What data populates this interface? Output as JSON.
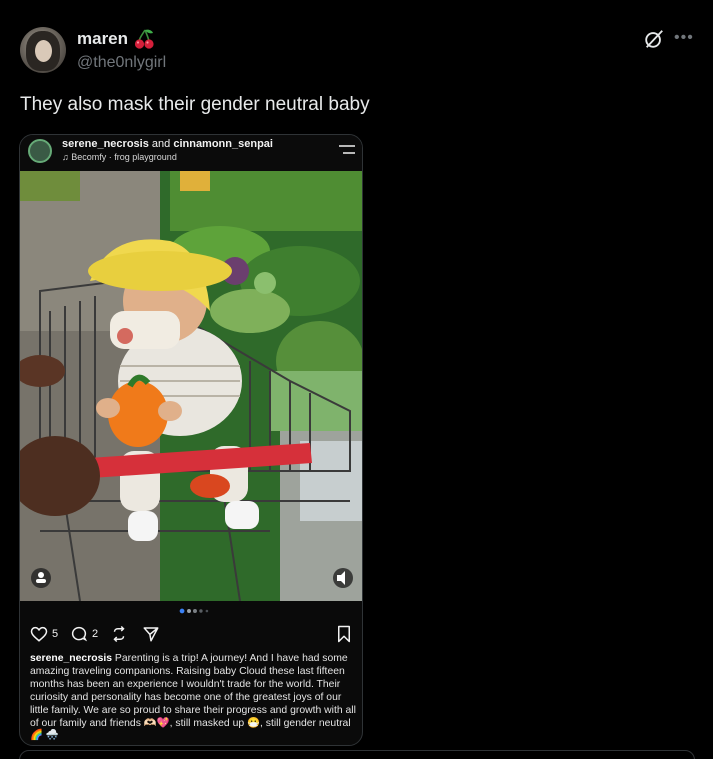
{
  "author": {
    "display_name": "maren",
    "handle": "@the0nlygirl",
    "badge_icon": "cherry-icon"
  },
  "header_icons": [
    "grok-icon",
    "more-icon"
  ],
  "more_glyph": "•••",
  "tweet": {
    "text": "They also mask their gender neutral baby"
  },
  "embedded_post": {
    "user1": "serene_necrosis",
    "and_text": "and",
    "user2": "cinnamonn_senpai",
    "music": "Becomfy · frog playground",
    "likes": "5",
    "comments": "2",
    "caption_user": "serene_necrosis",
    "caption_text": "Parenting is a trip! A journey! And I have had some amazing traveling companions. Raising baby Cloud these last fifteen months has been an experience I wouldn't trade for the world. Their curiosity and personality has become one of the greatest joys of our little family. We are so proud to share their progress and growth with all of our family and friends 🫶🏻💖, still masked up 😷, still gender neutral 🌈 🌨️"
  },
  "colors": {
    "background": "#000000",
    "text_primary": "#e7e9ea",
    "text_secondary": "#71767b",
    "border": "#2f3336",
    "carousel_active": "#3b82f6"
  }
}
